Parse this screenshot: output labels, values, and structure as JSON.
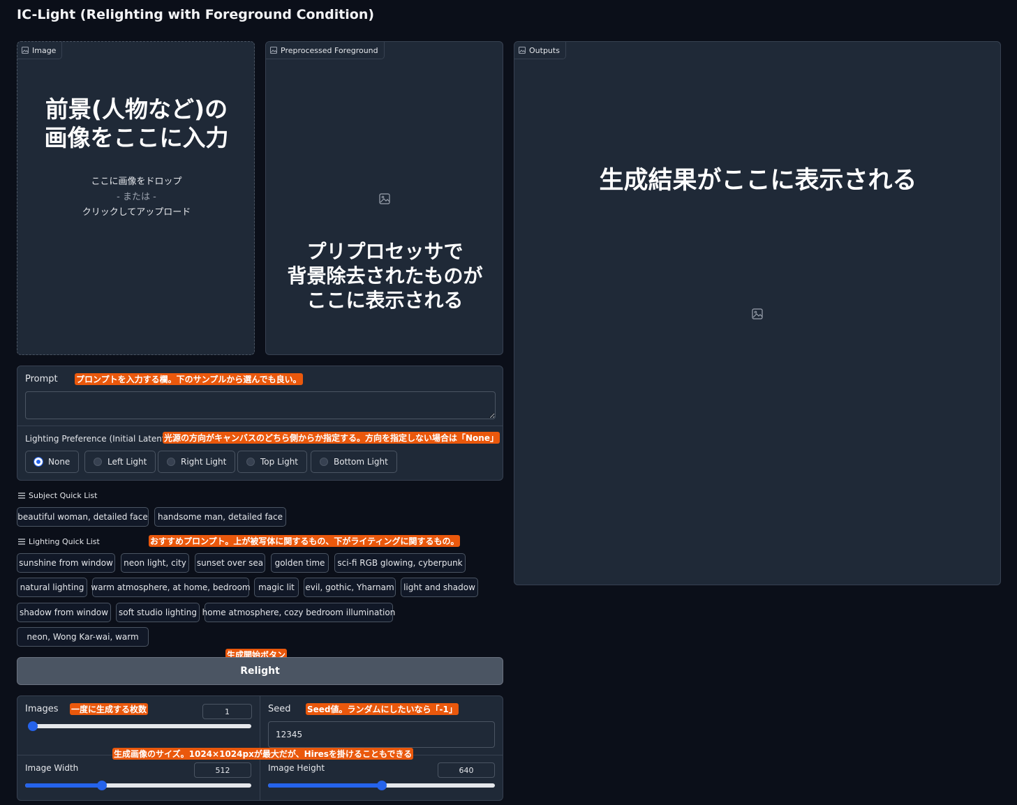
{
  "app": {
    "title": "IC-Light (Relighting with Foreground Condition)"
  },
  "image_panel": {
    "label": "Image",
    "overlay_line1": "前景(人物など)の",
    "overlay_line2": "画像をここに入力",
    "drop_line1": "ここに画像をドロップ",
    "drop_line2": "- または -",
    "drop_line3": "クリックしてアップロード",
    "icon": "image-icon"
  },
  "preprocessed_panel": {
    "label": "Preprocessed Foreground",
    "overlay_line1": "プリプロセッサで",
    "overlay_line2": "背景除去されたものが",
    "overlay_line3": "ここに表示される",
    "icon": "image-placeholder-icon"
  },
  "outputs_panel": {
    "label": "Outputs",
    "overlay": "生成結果がここに表示される",
    "icon": "image-placeholder-icon"
  },
  "prompt": {
    "label": "Prompt",
    "annotation": "プロンプトを入力する欄。下のサンプルから選んでも良い。",
    "value": ""
  },
  "lighting": {
    "label": "Lighting Preference (Initial Latent)",
    "annotation": "光源の方向がキャンバスのどちら側からか指定する。方向を指定しない場合は「None」",
    "options": [
      "None",
      "Left Light",
      "Right Light",
      "Top Light",
      "Bottom Light"
    ],
    "selected": "None"
  },
  "subject_quick_list": {
    "label": "Subject Quick List",
    "items": [
      "beautiful woman, detailed face",
      "handsome man, detailed face"
    ]
  },
  "lighting_quick_list": {
    "label": "Lighting Quick List",
    "annotation": "おすすめプロンプト。上が被写体に関するもの、下がライティングに関するもの。",
    "items": [
      "sunshine from window",
      "neon light, city",
      "sunset over sea",
      "golden time",
      "sci-fi RGB glowing, cyberpunk",
      "natural lighting",
      "warm atmosphere, at home, bedroom",
      "magic lit",
      "evil, gothic, Yharnam",
      "light and shadow",
      "shadow from window",
      "soft studio lighting",
      "home atmosphere, cozy bedroom illumination",
      "neon, Wong Kar-wai, warm"
    ]
  },
  "relight": {
    "label": "Relight",
    "annotation": "生成開始ボタン"
  },
  "images_setting": {
    "label": "Images",
    "annotation": "一度に生成する枚数",
    "value": "1",
    "slider_fraction": 0.0
  },
  "seed_setting": {
    "label": "Seed",
    "annotation": "Seed値。ランダムにしたいなら「-1」",
    "value": "12345"
  },
  "size_annotation": "生成画像のサイズ。1024×1024pxが最大だが、Hiresを掛けることもできる",
  "width_setting": {
    "label": "Image Width",
    "value": "512",
    "slider_fraction": 0.34
  },
  "height_setting": {
    "label": "Image Height",
    "value": "640",
    "slider_fraction": 0.5
  },
  "colors": {
    "background": "#0b0f19",
    "panel": "#1f2937",
    "accent": "#2563eb",
    "annotation": "#ea580c"
  }
}
